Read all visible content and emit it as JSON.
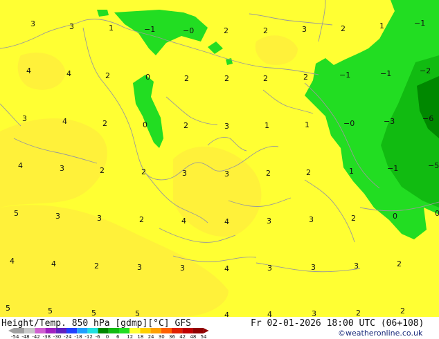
{
  "map": {
    "title_left": "Height/Temp. 850 hPa [gdmp][°C] GFS",
    "title_right": "Fr 02-01-2026 18:00 UTC (06+108)",
    "credit": "©weatheronline.co.uk",
    "colors": {
      "yellow": "#ffff33",
      "yellow_dark": "#ffe840",
      "green_light": "#22dd22",
      "green": "#11bb11",
      "green_dark": "#008800",
      "coast": "#9a9a9a"
    }
  },
  "labels": [
    {
      "t": "3"
    },
    {
      "t": "3"
    },
    {
      "t": "1"
    },
    {
      "t": "−1"
    },
    {
      "t": "−0"
    },
    {
      "t": "2"
    },
    {
      "t": "2"
    },
    {
      "t": "3"
    },
    {
      "t": "2"
    },
    {
      "t": "1"
    },
    {
      "t": "−1"
    },
    {
      "t": "4"
    },
    {
      "t": "4"
    },
    {
      "t": "2"
    },
    {
      "t": "0"
    },
    {
      "t": "2"
    },
    {
      "t": "2"
    },
    {
      "t": "2"
    },
    {
      "t": "2"
    },
    {
      "t": "−1"
    },
    {
      "t": "−1"
    },
    {
      "t": "−2"
    },
    {
      "t": "3"
    },
    {
      "t": "4"
    },
    {
      "t": "2"
    },
    {
      "t": "0"
    },
    {
      "t": "2"
    },
    {
      "t": "3"
    },
    {
      "t": "1"
    },
    {
      "t": "1"
    },
    {
      "t": "−0"
    },
    {
      "t": "−3"
    },
    {
      "t": "−6"
    },
    {
      "t": "4"
    },
    {
      "t": "3"
    },
    {
      "t": "2"
    },
    {
      "t": "2"
    },
    {
      "t": "3"
    },
    {
      "t": "3"
    },
    {
      "t": "2"
    },
    {
      "t": "2"
    },
    {
      "t": "1"
    },
    {
      "t": "−1"
    },
    {
      "t": "−5"
    },
    {
      "t": "5"
    },
    {
      "t": "3"
    },
    {
      "t": "3"
    },
    {
      "t": "2"
    },
    {
      "t": "4"
    },
    {
      "t": "4"
    },
    {
      "t": "3"
    },
    {
      "t": "3"
    },
    {
      "t": "2"
    },
    {
      "t": "0"
    },
    {
      "t": "0"
    },
    {
      "t": "4"
    },
    {
      "t": "4"
    },
    {
      "t": "2"
    },
    {
      "t": "3"
    },
    {
      "t": "3"
    },
    {
      "t": "4"
    },
    {
      "t": "3"
    },
    {
      "t": "3"
    },
    {
      "t": "3"
    },
    {
      "t": "2"
    },
    {
      "t": "5"
    },
    {
      "t": "5"
    },
    {
      "t": "5"
    },
    {
      "t": "5"
    },
    {
      "t": "4"
    },
    {
      "t": "4"
    },
    {
      "t": "3"
    },
    {
      "t": "2"
    },
    {
      "t": "2"
    }
  ],
  "colorbar": {
    "ticks": [
      "-54",
      "-48",
      "-42",
      "-38",
      "-30",
      "-24",
      "-18",
      "-12",
      "-6",
      "0",
      "6",
      "12",
      "18",
      "24",
      "30",
      "36",
      "42",
      "48",
      "54"
    ],
    "colors": [
      "#a0a0a0",
      "#c8c8c8",
      "#d060d0",
      "#a020c0",
      "#6020c0",
      "#2040ff",
      "#20a0ff",
      "#20e0e0",
      "#008800",
      "#11bb11",
      "#22dd22",
      "#ffff33",
      "#ffd000",
      "#ffa000",
      "#ff6000",
      "#e02000",
      "#c00000",
      "#900000"
    ]
  }
}
